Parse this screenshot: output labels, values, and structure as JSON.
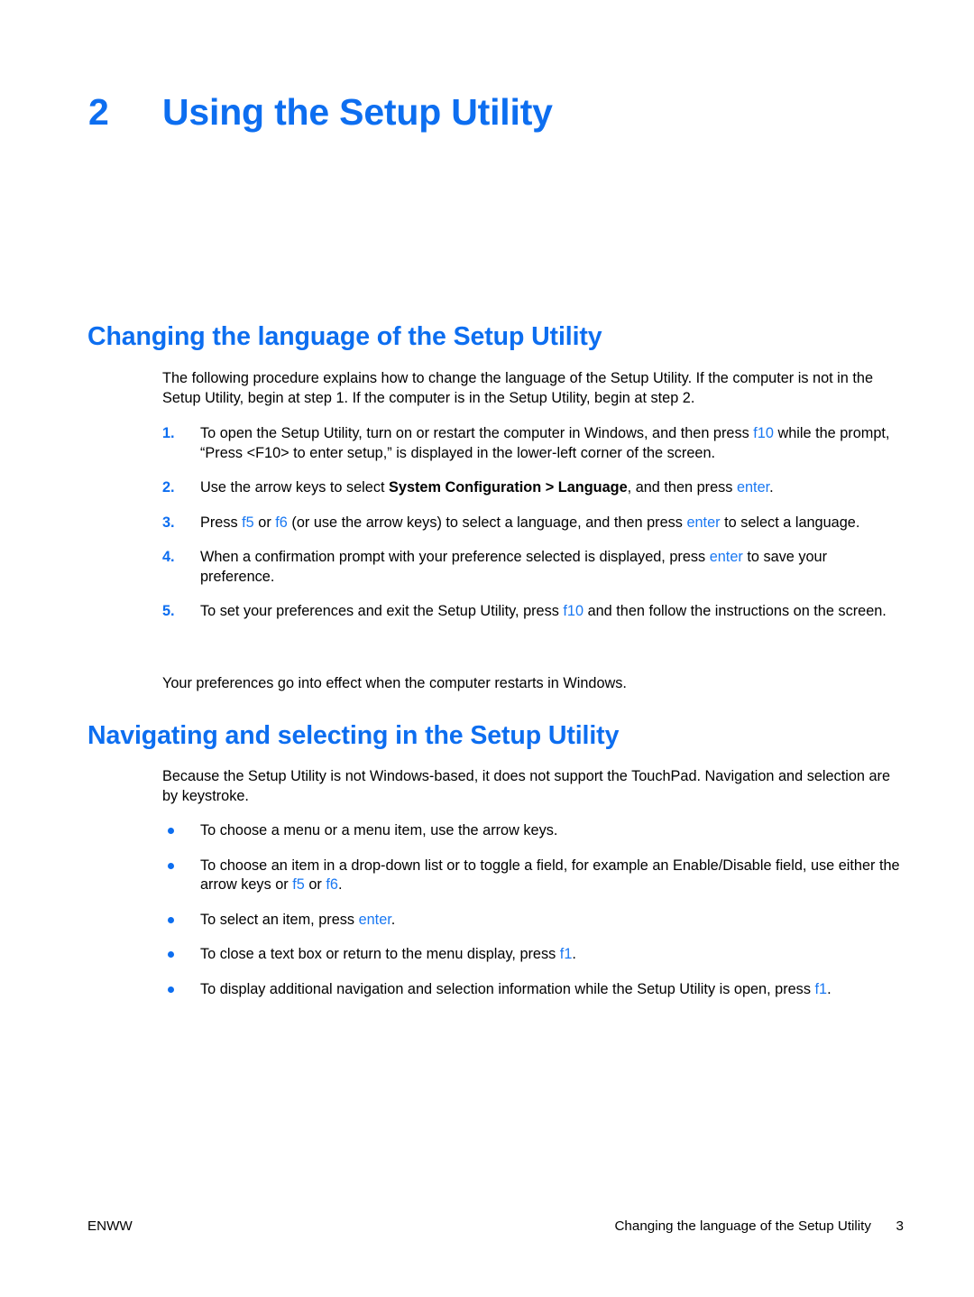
{
  "page": {
    "background": "#ffffff",
    "accent_blue": "#0d6ef0",
    "keyword_blue": "#1a78f2"
  },
  "chapter": {
    "number": "2",
    "title": "Using the Setup Utility"
  },
  "sections": [
    {
      "heading": "Changing the language of the Setup Utility",
      "intro": "The following procedure explains how to change the language of the Setup Utility. If the computer is not in the Setup Utility, begin at step 1. If the computer is in the Setup Utility, begin at step 2.",
      "steps": [
        {
          "number": "1.",
          "parts": [
            {
              "text": "To open the Setup Utility, turn on or restart the computer in Windows, and then press ",
              "style": "normal"
            },
            {
              "text": "f10",
              "style": "key"
            },
            {
              "text": " while the prompt, “Press <F10> to enter setup,” is displayed in the lower-left corner of the screen.",
              "style": "normal"
            }
          ]
        },
        {
          "number": "2.",
          "parts": [
            {
              "text": "Use the arrow keys to select ",
              "style": "normal"
            },
            {
              "text": "System Configuration > Language",
              "style": "bold"
            },
            {
              "text": ", and then press ",
              "style": "normal"
            },
            {
              "text": "enter",
              "style": "key"
            },
            {
              "text": ".",
              "style": "normal"
            }
          ]
        },
        {
          "number": "3.",
          "parts": [
            {
              "text": "Press ",
              "style": "normal"
            },
            {
              "text": "f5",
              "style": "key"
            },
            {
              "text": " or ",
              "style": "normal"
            },
            {
              "text": "f6",
              "style": "key"
            },
            {
              "text": " (or use the arrow keys) to select a language, and then press ",
              "style": "normal"
            },
            {
              "text": "enter",
              "style": "key"
            },
            {
              "text": " to select a language.",
              "style": "normal"
            }
          ]
        },
        {
          "number": "4.",
          "parts": [
            {
              "text": "When a confirmation prompt with your preference selected is displayed, press ",
              "style": "normal"
            },
            {
              "text": "enter",
              "style": "key"
            },
            {
              "text": " to save your preference.",
              "style": "normal"
            }
          ]
        },
        {
          "number": "5.",
          "parts": [
            {
              "text": "To set your preferences and exit the Setup Utility, press ",
              "style": "normal"
            },
            {
              "text": "f10",
              "style": "key"
            },
            {
              "text": " and then follow the instructions on the screen.",
              "style": "normal"
            }
          ]
        }
      ],
      "closing": "Your preferences go into effect when the computer restarts in Windows."
    },
    {
      "heading": "Navigating and selecting in the Setup Utility",
      "intro": "Because the Setup Utility is not Windows-based, it does not support the TouchPad. Navigation and selection are by keystroke.",
      "bullets": [
        {
          "parts": [
            {
              "text": "To choose a menu or a menu item, use the arrow keys.",
              "style": "normal"
            }
          ]
        },
        {
          "parts": [
            {
              "text": "To choose an item in a drop-down list or to toggle a field, for example an Enable/Disable field, use either the arrow keys or ",
              "style": "normal"
            },
            {
              "text": "f5",
              "style": "key"
            },
            {
              "text": " or ",
              "style": "normal"
            },
            {
              "text": "f6",
              "style": "key"
            },
            {
              "text": ".",
              "style": "normal"
            }
          ]
        },
        {
          "parts": [
            {
              "text": "To select an item, press ",
              "style": "normal"
            },
            {
              "text": "enter",
              "style": "key"
            },
            {
              "text": ".",
              "style": "normal"
            }
          ]
        },
        {
          "parts": [
            {
              "text": "To close a text box or return to the menu display, press ",
              "style": "normal"
            },
            {
              "text": "f1",
              "style": "key"
            },
            {
              "text": ".",
              "style": "normal"
            }
          ]
        },
        {
          "parts": [
            {
              "text": "To display additional navigation and selection information while the Setup Utility is open, press ",
              "style": "normal"
            },
            {
              "text": "f1",
              "style": "key"
            },
            {
              "text": ".",
              "style": "normal"
            }
          ]
        }
      ]
    }
  ],
  "footer": {
    "left": "ENWW",
    "section_title": "Changing the language of the Setup Utility",
    "page_number": "3"
  }
}
